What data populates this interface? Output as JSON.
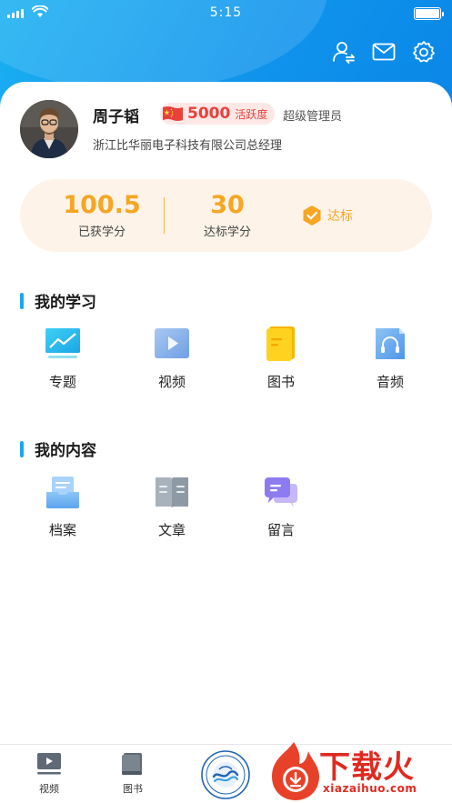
{
  "status_bar": {
    "time": "5:15"
  },
  "profile": {
    "name": "周子韬",
    "points": "5000",
    "points_label": "活跃度",
    "role": "超级管理员",
    "company": "浙江比华丽电子科技有限公司总经理"
  },
  "credits": {
    "earned_value": "100.5",
    "earned_label": "已获学分",
    "target_value": "30",
    "target_label": "达标学分",
    "status_label": "达标"
  },
  "sections": {
    "learning": {
      "title": "我的学习",
      "items": [
        {
          "label": "专题",
          "icon": "topic-icon"
        },
        {
          "label": "视频",
          "icon": "video-icon"
        },
        {
          "label": "图书",
          "icon": "book-icon"
        },
        {
          "label": "音频",
          "icon": "audio-icon"
        }
      ]
    },
    "content": {
      "title": "我的内容",
      "items": [
        {
          "label": "档案",
          "icon": "archive-icon"
        },
        {
          "label": "文章",
          "icon": "article-icon"
        },
        {
          "label": "留言",
          "icon": "message-icon"
        }
      ]
    }
  },
  "tabbar": {
    "tabs": [
      {
        "label": "视频",
        "icon": "video-tab-icon"
      },
      {
        "label": "图书",
        "icon": "book-tab-icon"
      }
    ]
  },
  "watermark": {
    "main": "下载火",
    "sub": "xiazaihuo.com"
  },
  "colors": {
    "header_blue": "#0f93ec",
    "accent_orange": "#f5a623",
    "badge_red": "#e8413c",
    "section_bar": "#1aa6f0"
  }
}
